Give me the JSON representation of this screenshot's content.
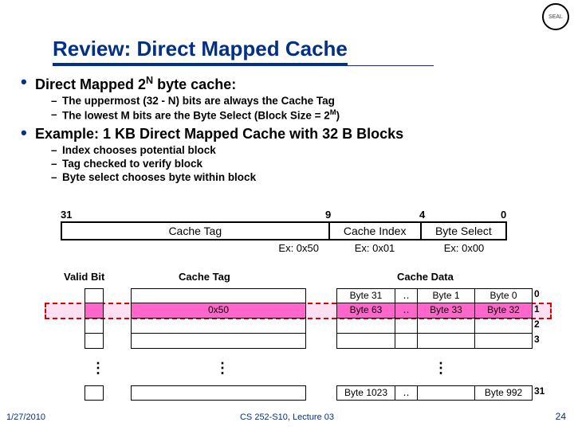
{
  "seal": "SEAL",
  "title": "Review: Direct Mapped Cache",
  "b1_pre": "Direct Mapped 2",
  "b1_sup": "N",
  "b1_post": " byte cache:",
  "s1": "The uppermost (32 - N) bits are always the Cache Tag",
  "s2_pre": "The lowest M bits are the Byte Select (Block Size = 2",
  "s2_sup": "M",
  "s2_post": ")",
  "b2": "Example: 1 KB Direct Mapped Cache with 32 B Blocks",
  "s3": "Index chooses potential block",
  "s4": "Tag checked to verify block",
  "s5": "Byte select chooses byte within block",
  "bits": {
    "b31": "31",
    "b9": "9",
    "b4": "4",
    "b0": "0"
  },
  "addr": {
    "tag": "Cache Tag",
    "index": "Cache Index",
    "bsel": "Byte Select"
  },
  "ex": {
    "tag": "Ex: 0x50",
    "index": "Ex: 0x01",
    "bsel": "Ex: 0x00"
  },
  "th": {
    "valid": "Valid Bit",
    "tag": "Cache Tag",
    "data": "Cache Data"
  },
  "row0": {
    "c0": "Byte 31",
    "dots": "‥",
    "c1": "Byte 1",
    "c2": "Byte 0"
  },
  "row1": {
    "tag": "0x50",
    "c0": "Byte 63",
    "dots": "‥",
    "c1": "Byte 33",
    "c2": "Byte 32"
  },
  "rowN": {
    "c0": "Byte 1023",
    "dots": "‥",
    "c2": "Byte 992"
  },
  "idx": {
    "r0": "0",
    "r1": "1",
    "r2": "2",
    "r3": "3",
    "rN": "31"
  },
  "vd": "⋮",
  "footer": {
    "date": "1/27/2010",
    "center": "CS 252-S10, Lecture 03",
    "num": "24"
  }
}
